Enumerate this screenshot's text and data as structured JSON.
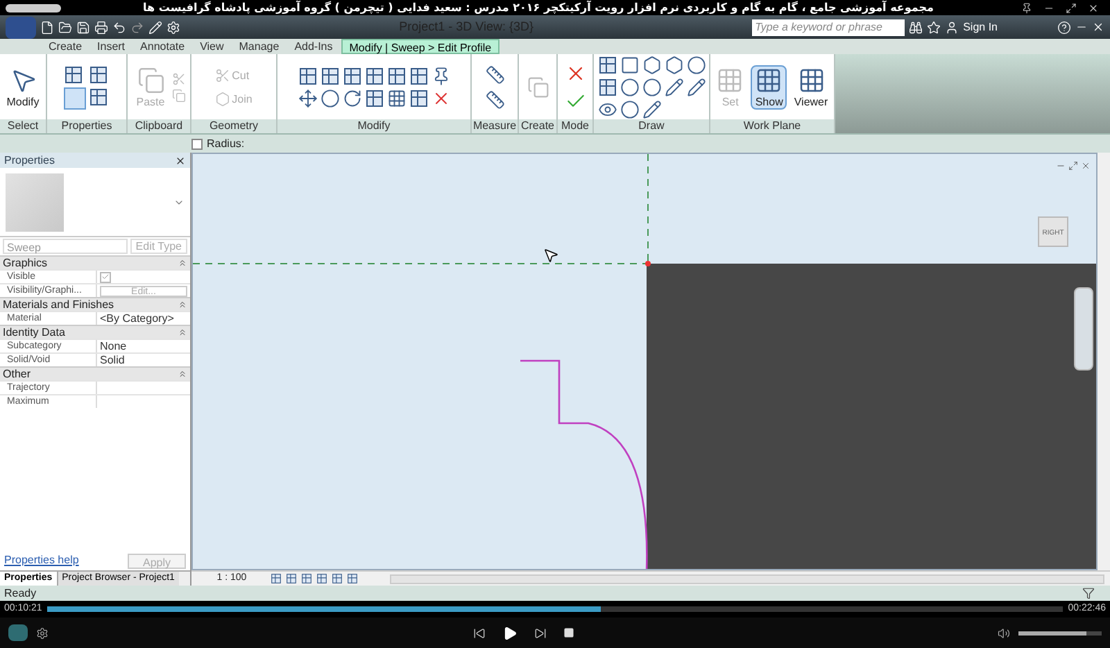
{
  "player": {
    "title": "مجموعه آموزشی جامع ، گام به گام و کاربردی نرم افزار رویت آرکیتکچر ۲۰۱۶  مدرس : سعید فدایی ( تیچرمن ) گروه آموزشی پادشاه گرافیست ها",
    "current_time": "00:10:21",
    "total_time": "00:22:46",
    "progress": {
      "level": 0.545
    },
    "volume": {
      "level": 0.82
    }
  },
  "app": {
    "window_title": "Project1 - 3D View: {3D}",
    "search": {
      "placeholder": "Type a keyword or phrase"
    },
    "sign_in": "Sign In"
  },
  "ribbon_tabs": [
    {
      "label": "Create",
      "selected": false
    },
    {
      "label": "Insert",
      "selected": false
    },
    {
      "label": "Annotate",
      "selected": false
    },
    {
      "label": "View",
      "selected": false
    },
    {
      "label": "Manage",
      "selected": false
    },
    {
      "label": "Add-Ins",
      "selected": false
    },
    {
      "label": "Modify | Sweep > Edit Profile",
      "selected": true
    }
  ],
  "ribbon_panels": [
    {
      "label": "Select",
      "tools": [
        {
          "label": "Modify",
          "disabled": false
        }
      ]
    },
    {
      "label": "Properties",
      "selected": true
    },
    {
      "label": "Clipboard",
      "tools": [
        {
          "label": "Paste",
          "disabled": true
        }
      ]
    },
    {
      "label": "Geometry",
      "tools": [
        {
          "label": "Cut",
          "disabled": true
        },
        {
          "label": "Join",
          "disabled": true
        }
      ]
    },
    {
      "label": "Modify"
    },
    {
      "label": "Measure"
    },
    {
      "label": "Create"
    },
    {
      "label": "Mode"
    },
    {
      "label": "Draw"
    },
    {
      "label": "Work Plane",
      "tools": [
        {
          "label": "Set",
          "disabled": true,
          "selected": false
        },
        {
          "label": "Show",
          "disabled": false,
          "selected": true
        },
        {
          "label": "Viewer",
          "disabled": false,
          "selected": false
        }
      ]
    }
  ],
  "options_bar": {
    "radius": {
      "label": "Radius:",
      "checked": false
    }
  },
  "properties": {
    "title": "Properties",
    "type_name": "Sweep",
    "edit_type": "Edit Type",
    "groups": [
      {
        "label": "Graphics",
        "rows": [
          {
            "name": "Visible",
            "kind": "checkbox",
            "checked": true
          },
          {
            "name": "Visibility/Graphi...",
            "kind": "button",
            "value": "Edit..."
          }
        ]
      },
      {
        "label": "Materials and Finishes",
        "rows": [
          {
            "name": "Material",
            "kind": "text",
            "value": "<By Category>"
          }
        ]
      },
      {
        "label": "Identity Data",
        "rows": [
          {
            "name": "Subcategory",
            "kind": "text",
            "value": "None"
          },
          {
            "name": "Solid/Void",
            "kind": "text",
            "value": "Solid"
          }
        ]
      },
      {
        "label": "Other",
        "rows": [
          {
            "name": "Trajectory",
            "kind": "text",
            "value": ""
          },
          {
            "name": "Maximum",
            "kind": "text",
            "value": ""
          }
        ]
      }
    ],
    "help_link": "Properties help",
    "apply": "Apply"
  },
  "bottom_tabs": [
    {
      "label": "Properties",
      "selected": true
    },
    {
      "label": "Project Browser - Project1",
      "selected": false
    }
  ],
  "view": {
    "scale": "1 : 100",
    "view_cube": "RIGHT"
  },
  "status": "Ready"
}
